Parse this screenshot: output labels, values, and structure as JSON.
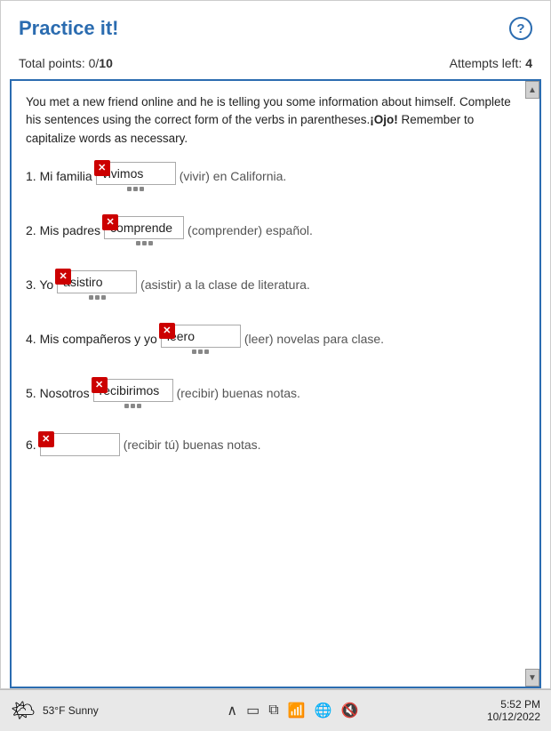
{
  "header": {
    "title": "Practice it!",
    "help_label": "?"
  },
  "stats": {
    "total_points_label": "Total points:",
    "total_points_value": "0",
    "total_points_max": "10",
    "attempts_left_label": "Attempts left:",
    "attempts_left_value": "4"
  },
  "instruction": {
    "text1": "You met a new friend online and he is telling you some information about himself. Complete his sentences using the correct form of the verbs in parentheses.",
    "ojo": "¡Ojo!",
    "text2": " Remember to capitalize words as necessary."
  },
  "questions": [
    {
      "number": "1.",
      "prefix": "Mi familia",
      "answer": "vivimos",
      "hint": "(vivir) en California.",
      "has_error": true
    },
    {
      "number": "2.",
      "prefix": "Mis padres",
      "answer": "comprende",
      "hint": "(comprender) español.",
      "has_error": true
    },
    {
      "number": "3.",
      "prefix": "Yo",
      "answer": "asistiro",
      "hint": "(asistir) a la clase de literatura.",
      "has_error": true
    },
    {
      "number": "4.",
      "prefix": "Mis compañeros y yo",
      "answer": "leero",
      "hint": "(leer) novelas para clase.",
      "has_error": true
    },
    {
      "number": "5.",
      "prefix": "Nosotros",
      "answer": "recibirimos",
      "hint": "(recibir) buenas notas.",
      "has_error": true
    },
    {
      "number": "6.",
      "prefix": "",
      "answer": "",
      "hint": "(recibir tú) buenas notas.",
      "has_error": true
    }
  ],
  "taskbar": {
    "weather_icon": "🌤",
    "temp": "53°F",
    "condition": "Sunny",
    "time": "5:52 PM",
    "date": "10/12/2022"
  }
}
